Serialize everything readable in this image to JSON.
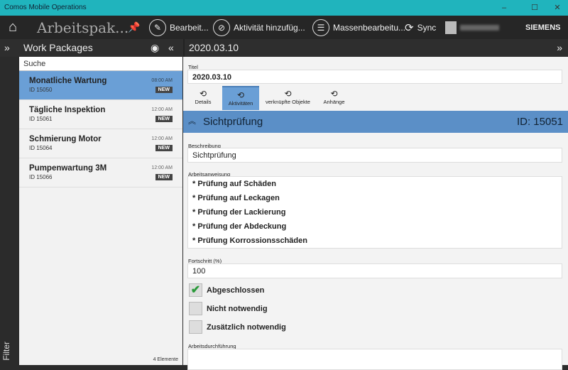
{
  "window": {
    "title": "Comos Mobile Operations",
    "min": "–",
    "max": "☐",
    "close": "✕"
  },
  "toolbar": {
    "app_title": "Arbeitspak...",
    "edit": "Bearbeit...",
    "add_activity": "Aktivität hinzufüg...",
    "bulk_edit": "Massenbearbeitu...",
    "sync": "Sync",
    "brand": "SIEMENS"
  },
  "left": {
    "header": "Work Packages",
    "search_placeholder": "Suche",
    "count": "4 Elemente",
    "filter": "Filter",
    "items": [
      {
        "name": "Monatliche Wartung",
        "id": "ID 15050",
        "time": "08:00 AM",
        "badge": "NEW"
      },
      {
        "name": "Tägliche Inspektion",
        "id": "ID 15061",
        "time": "12:00 AM",
        "badge": "NEW"
      },
      {
        "name": "Schmierung Motor",
        "id": "ID 15064",
        "time": "12:00 AM",
        "badge": "NEW"
      },
      {
        "name": "Pumpenwartung 3M",
        "id": "ID 15066",
        "time": "12:00 AM",
        "badge": "NEW"
      }
    ]
  },
  "right": {
    "header": "2020.03.10",
    "title_label": "Titel",
    "title_value": "2020.03.10",
    "tabs": [
      "Details",
      "Aktivitäten",
      "verknüpfte Objekte",
      "Anhänge"
    ],
    "section": {
      "name": "Sichtprüfung",
      "id": "ID: 15051"
    },
    "desc_label": "Beschreibung",
    "desc_value": "Sichtprüfung",
    "instr_label": "Arbeitsanweisung",
    "instructions": [
      "* Prüfung auf Schäden",
      "* Prüfung auf Leckagen",
      "* Prüfung der Lackierung",
      "* Prüfung der Abdeckung",
      "* Prüfung Korrossionsschäden"
    ],
    "progress_label": "Fortschritt (%)",
    "progress_value": "100",
    "checks": [
      {
        "label": "Abgeschlossen",
        "checked": true
      },
      {
        "label": "Nicht notwendig",
        "checked": false
      },
      {
        "label": "Zusätzlich notwendig",
        "checked": false
      }
    ],
    "exec_label": "Arbeitsdurchführung"
  }
}
